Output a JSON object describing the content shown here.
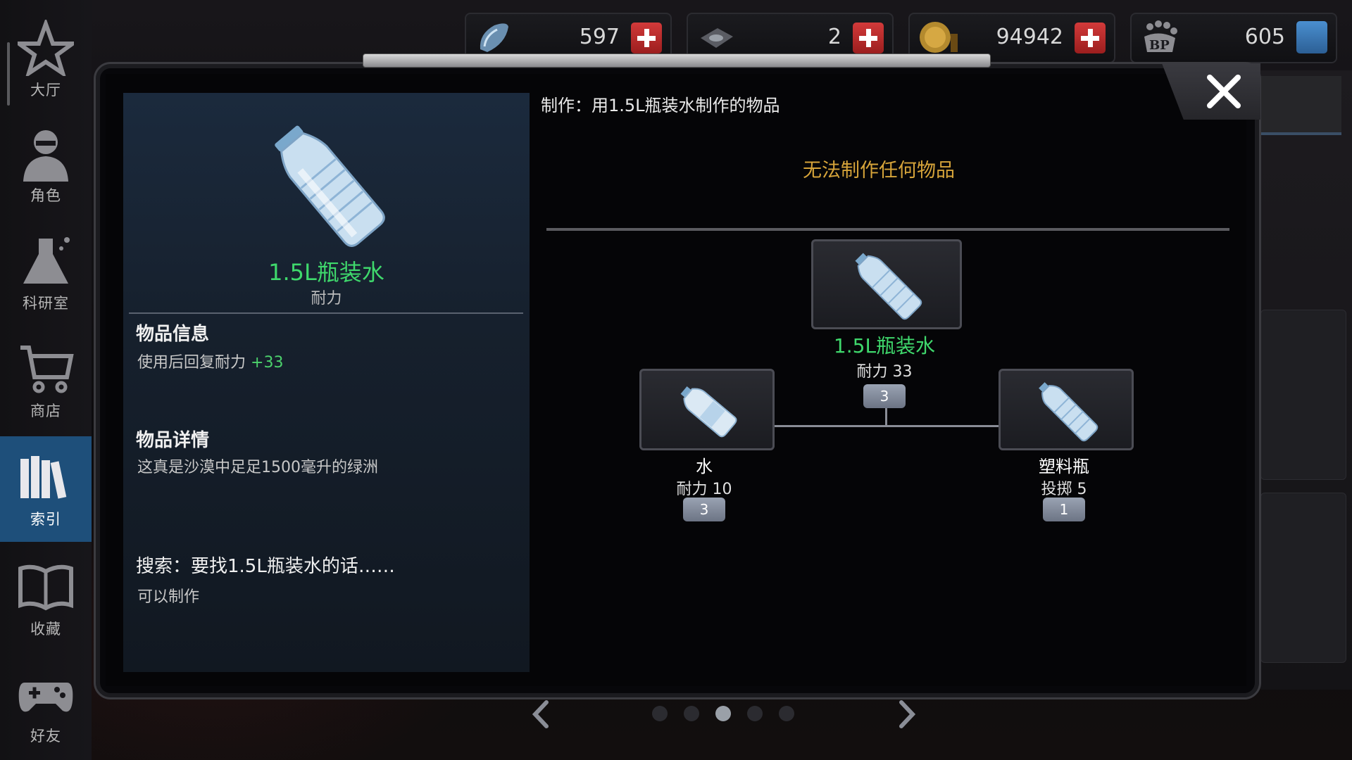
{
  "resources": [
    {
      "icon": "crystal-icon",
      "value": "597",
      "action": "plus"
    },
    {
      "icon": "scrap-icon",
      "value": "2",
      "action": "plus"
    },
    {
      "icon": "coin-icon",
      "value": "94942",
      "action": "plus"
    },
    {
      "icon": "bp-icon",
      "value": "605",
      "action": "card"
    }
  ],
  "sidebar": {
    "items": [
      {
        "label": "大厅",
        "icon": "lobby-icon"
      },
      {
        "label": "角色",
        "icon": "character-icon"
      },
      {
        "label": "科研室",
        "icon": "lab-flask-icon"
      },
      {
        "label": "商店",
        "icon": "shop-cart-icon"
      },
      {
        "label": "索引",
        "icon": "index-books-icon",
        "active": true
      },
      {
        "label": "收藏",
        "icon": "collection-book-icon"
      },
      {
        "label": "好友",
        "icon": "friends-gamepad-icon"
      }
    ]
  },
  "item": {
    "name": "1.5L瓶装水",
    "category": "耐力",
    "info_title": "物品信息",
    "info_text": "使用后回复耐力",
    "info_value": "+33",
    "detail_title": "物品详情",
    "detail_text": "这真是沙漠中足足1500毫升的绿洲",
    "search_title": "搜索：要找1.5L瓶装水的话……",
    "search_text": "可以制作"
  },
  "craft": {
    "title": "制作：用1.5L瓶装水制作的物品",
    "none_text": "无法制作任何物品",
    "result": {
      "name": "1.5L瓶装水",
      "stat": "耐力 33",
      "count": "3"
    },
    "ingredients": [
      {
        "name": "水",
        "stat": "耐力 10",
        "count": "3"
      },
      {
        "name": "塑料瓶",
        "stat": "投掷 5",
        "count": "1"
      }
    ]
  },
  "pager": {
    "total": 5,
    "current": 3
  }
}
